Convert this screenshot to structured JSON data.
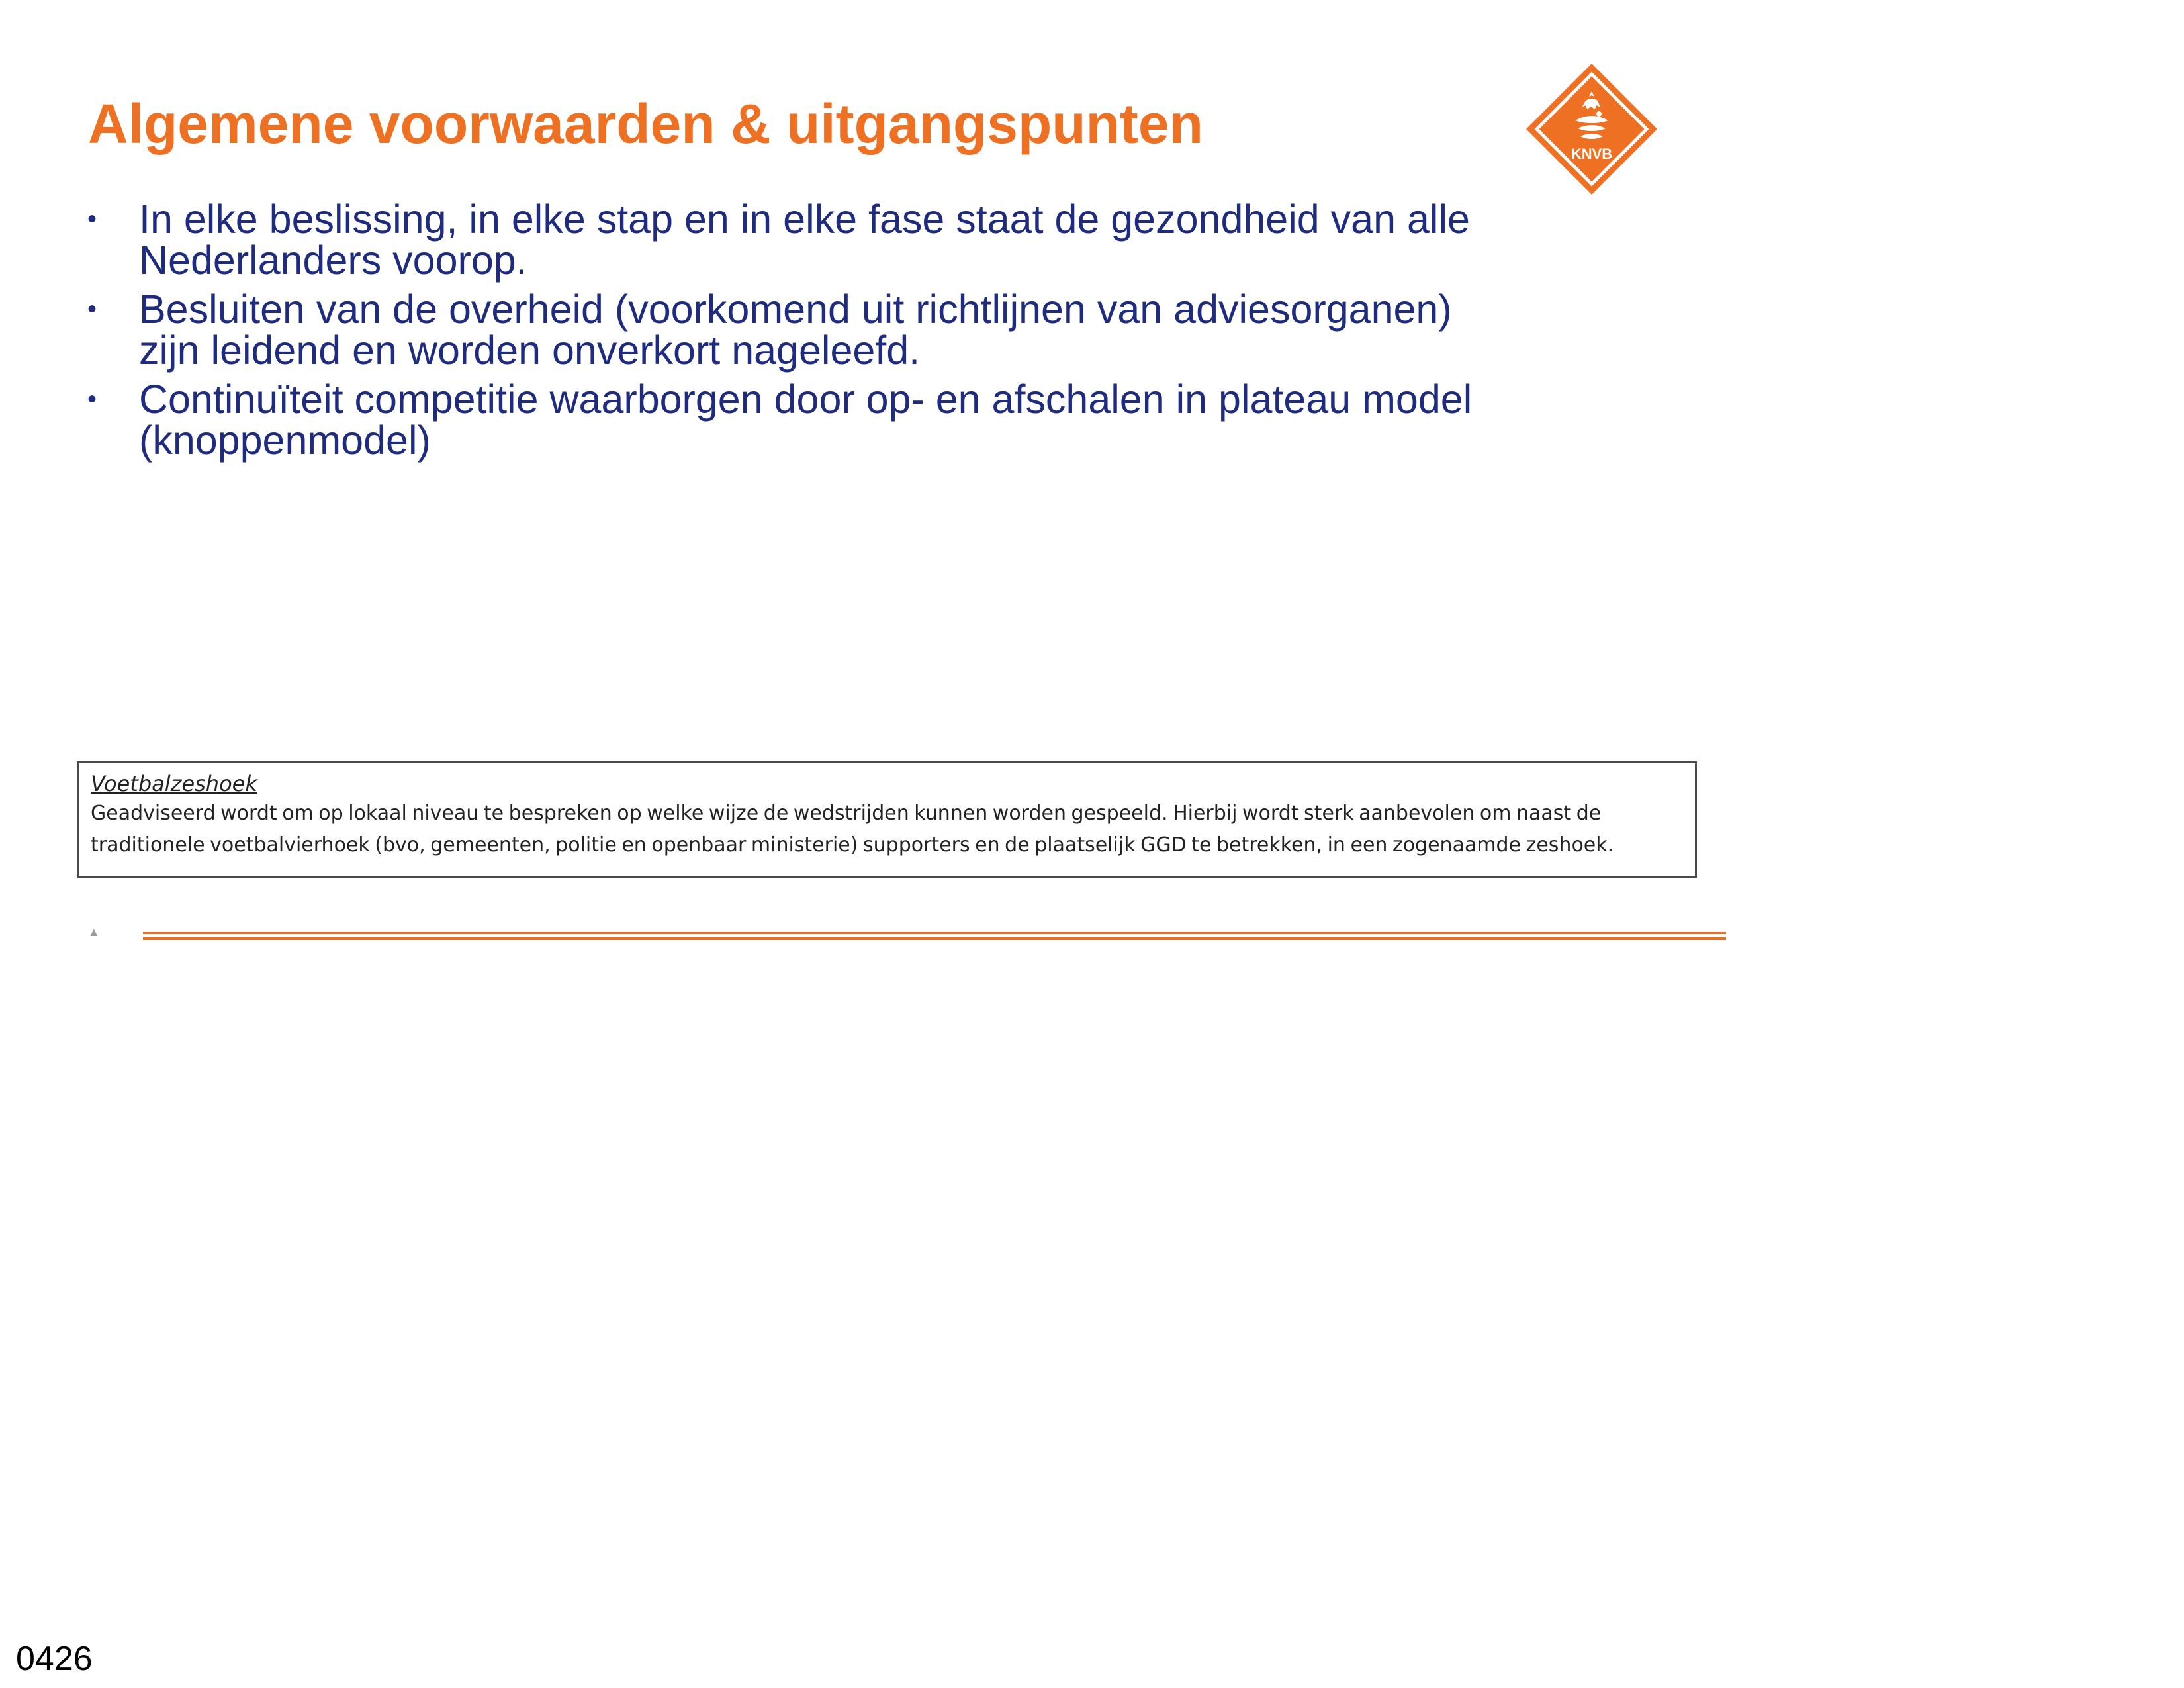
{
  "slide": {
    "title": "Algemene voorwaarden & uitgangspunten",
    "logo": {
      "icon": "knvb-lion-logo-icon",
      "text": "KNVB",
      "color": "#ee7023"
    },
    "bullets": [
      {
        "text": "In elke beslissing, in elke stap en in elke fase staat de gezondheid van alle Nederlanders voorop."
      },
      {
        "text": "Besluiten van de overheid (voorkomend uit richtlijnen van adviesorganen) zijn leidend en worden onverkort nageleefd."
      },
      {
        "text": "Continuïteit competitie waarborgen door op- en afschalen in plateau model (knoppenmodel)"
      }
    ],
    "note": {
      "title": "Voetbalzeshoek",
      "text": "Geadviseerd wordt om op lokaal niveau te bespreken op welke wijze de wedstrijden kunnen worden gespeeld. Hierbij wordt sterk aanbevolen om naast de traditionele voetbalvierhoek (bvo, gemeenten, politie en openbaar ministerie)  supporters en de plaatselijk GGD te betrekken, in een zogenaamde zeshoek."
    },
    "footer_mark": "▲"
  },
  "page_number": "0426",
  "colors": {
    "title": "#ee7023",
    "bullet_text": "#1e2b7e",
    "accent_line": "#ee7023"
  }
}
